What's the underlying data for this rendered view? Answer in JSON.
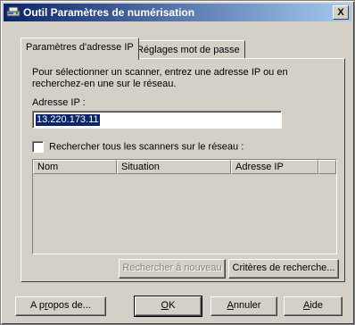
{
  "window": {
    "title": "Outil Paramètres de numérisation",
    "close_label": "X"
  },
  "tabs": [
    {
      "label": "Paramètres d'adresse IP",
      "active": true
    },
    {
      "label": "Réglages mot de passe",
      "active": false
    }
  ],
  "panel": {
    "description": "Pour sélectionner un scanner, entrez une adresse IP ou en recherchez-en une sur le réseau.",
    "ip_label": "Adresse IP :",
    "ip_value": "13.220.173.11",
    "search_all_label": "Rechercher tous les scanners sur le réseau :",
    "search_all_checked": false,
    "columns": [
      "Nom",
      "Situation",
      "Adresse IP"
    ],
    "search_again_label": "Rechercher à nouveau",
    "search_criteria_label": "Critères de recherche..."
  },
  "footer": {
    "about_pre": "A p",
    "about_key": "r",
    "about_post": "opos de...",
    "ok_key": "O",
    "ok_post": "K",
    "cancel_key": "A",
    "cancel_post": "nnuler",
    "help_key": "A",
    "help_post": "ide"
  },
  "colors": {
    "title_gradient_start": "#0a246a",
    "title_gradient_end": "#a6caf0",
    "dialog_bg": "#d4d0c8",
    "selection": "#0a246a"
  },
  "icons": {
    "title": "scanner-icon",
    "close": "close-icon"
  }
}
